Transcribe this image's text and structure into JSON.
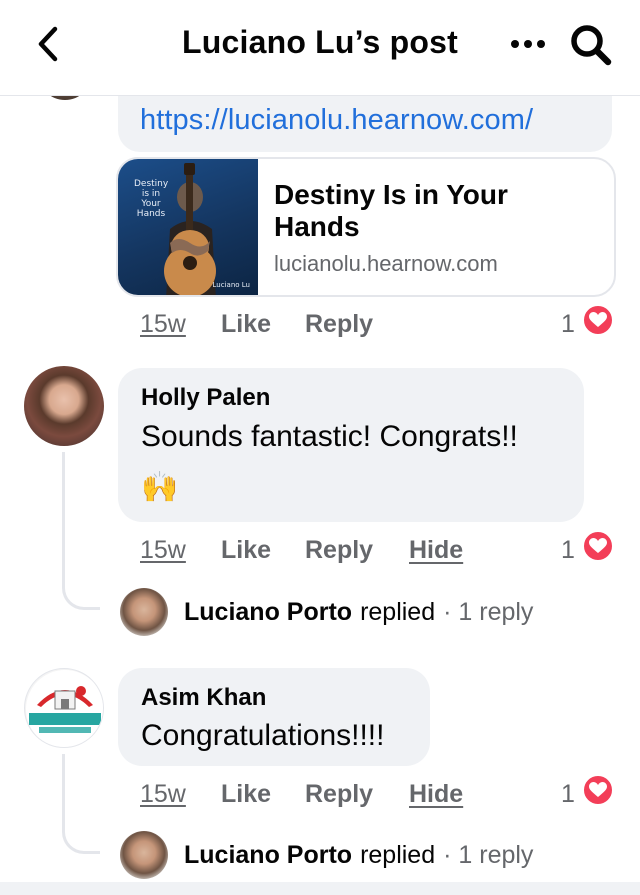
{
  "header": {
    "title": "Luciano Lu’s post",
    "back_icon": "chevron-left-icon",
    "more_icon": "more-horizontal-icon",
    "search_icon": "search-icon"
  },
  "link_comment": {
    "url_text": "https://lucianolu.hearnow.com/",
    "preview": {
      "title": "Destiny Is in Your Hands",
      "domain": "lucianolu.hearnow.com",
      "thumb_title": "Destiny is in Your Hands",
      "thumb_artist": "Luciano Lu"
    },
    "actions": {
      "time": "15w",
      "like": "Like",
      "reply": "Reply"
    },
    "reaction_count": "1"
  },
  "comments": [
    {
      "name": "Holly Palen",
      "text": "Sounds fantastic!  Congrats!!",
      "emoji": "🙌",
      "actions": {
        "time": "15w",
        "like": "Like",
        "reply": "Reply",
        "hide": "Hide"
      },
      "reaction_count": "1",
      "reply": {
        "name": "Luciano Porto",
        "verb": "replied",
        "count": "· 1 reply"
      }
    },
    {
      "name": "Asim Khan",
      "text": "Congratulations!!!!",
      "actions": {
        "time": "15w",
        "like": "Like",
        "reply": "Reply",
        "hide": "Hide"
      },
      "reaction_count": "1",
      "reply": {
        "name": "Luciano Porto",
        "verb": "replied",
        "count": "· 1 reply"
      }
    }
  ],
  "colors": {
    "link": "#216fdb",
    "bubble": "#f0f2f5",
    "secondary_text": "#65676b",
    "heart": "#f33e58"
  }
}
